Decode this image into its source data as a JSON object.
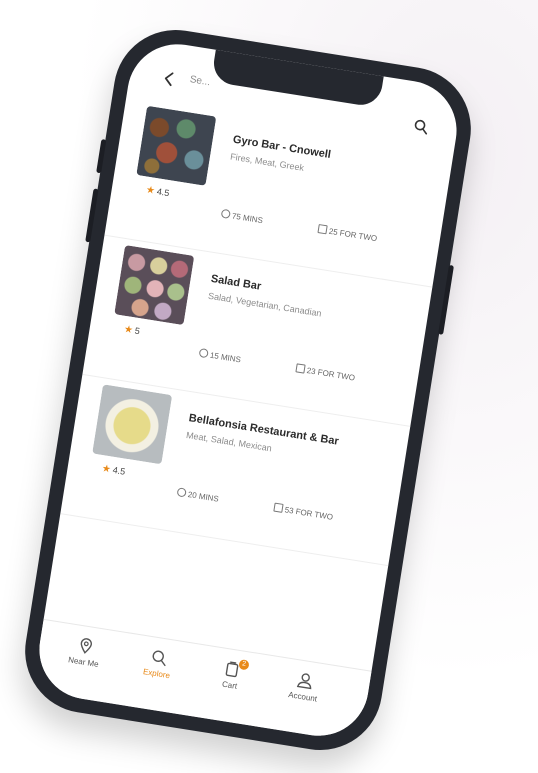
{
  "header": {
    "search_text": "Se..."
  },
  "colors": {
    "accent": "#e88a1a",
    "phone_frame": "#25282f"
  },
  "restaurants": [
    {
      "name": "Gyro Bar - Cnowell",
      "tags": "Fires, Meat, Greek",
      "rating": "4.5",
      "time": "75 MINS",
      "cost": "25 FOR TWO"
    },
    {
      "name": "Salad Bar",
      "tags": "Salad, Vegetarian, Canadian",
      "rating": "5",
      "time": "15 MINS",
      "cost": "23 FOR TWO"
    },
    {
      "name": "Bellafonsia Restaurant & Bar",
      "tags": "Meat, Salad, Mexican",
      "rating": "4.5",
      "time": "20 MINS",
      "cost": "53 FOR TWO"
    }
  ],
  "tabs": [
    {
      "label": "Near Me",
      "icon": "location-pin-icon"
    },
    {
      "label": "Explore",
      "icon": "search-icon"
    },
    {
      "label": "Cart",
      "icon": "cart-icon",
      "badge": "2"
    },
    {
      "label": "Account",
      "icon": "user-icon"
    }
  ]
}
